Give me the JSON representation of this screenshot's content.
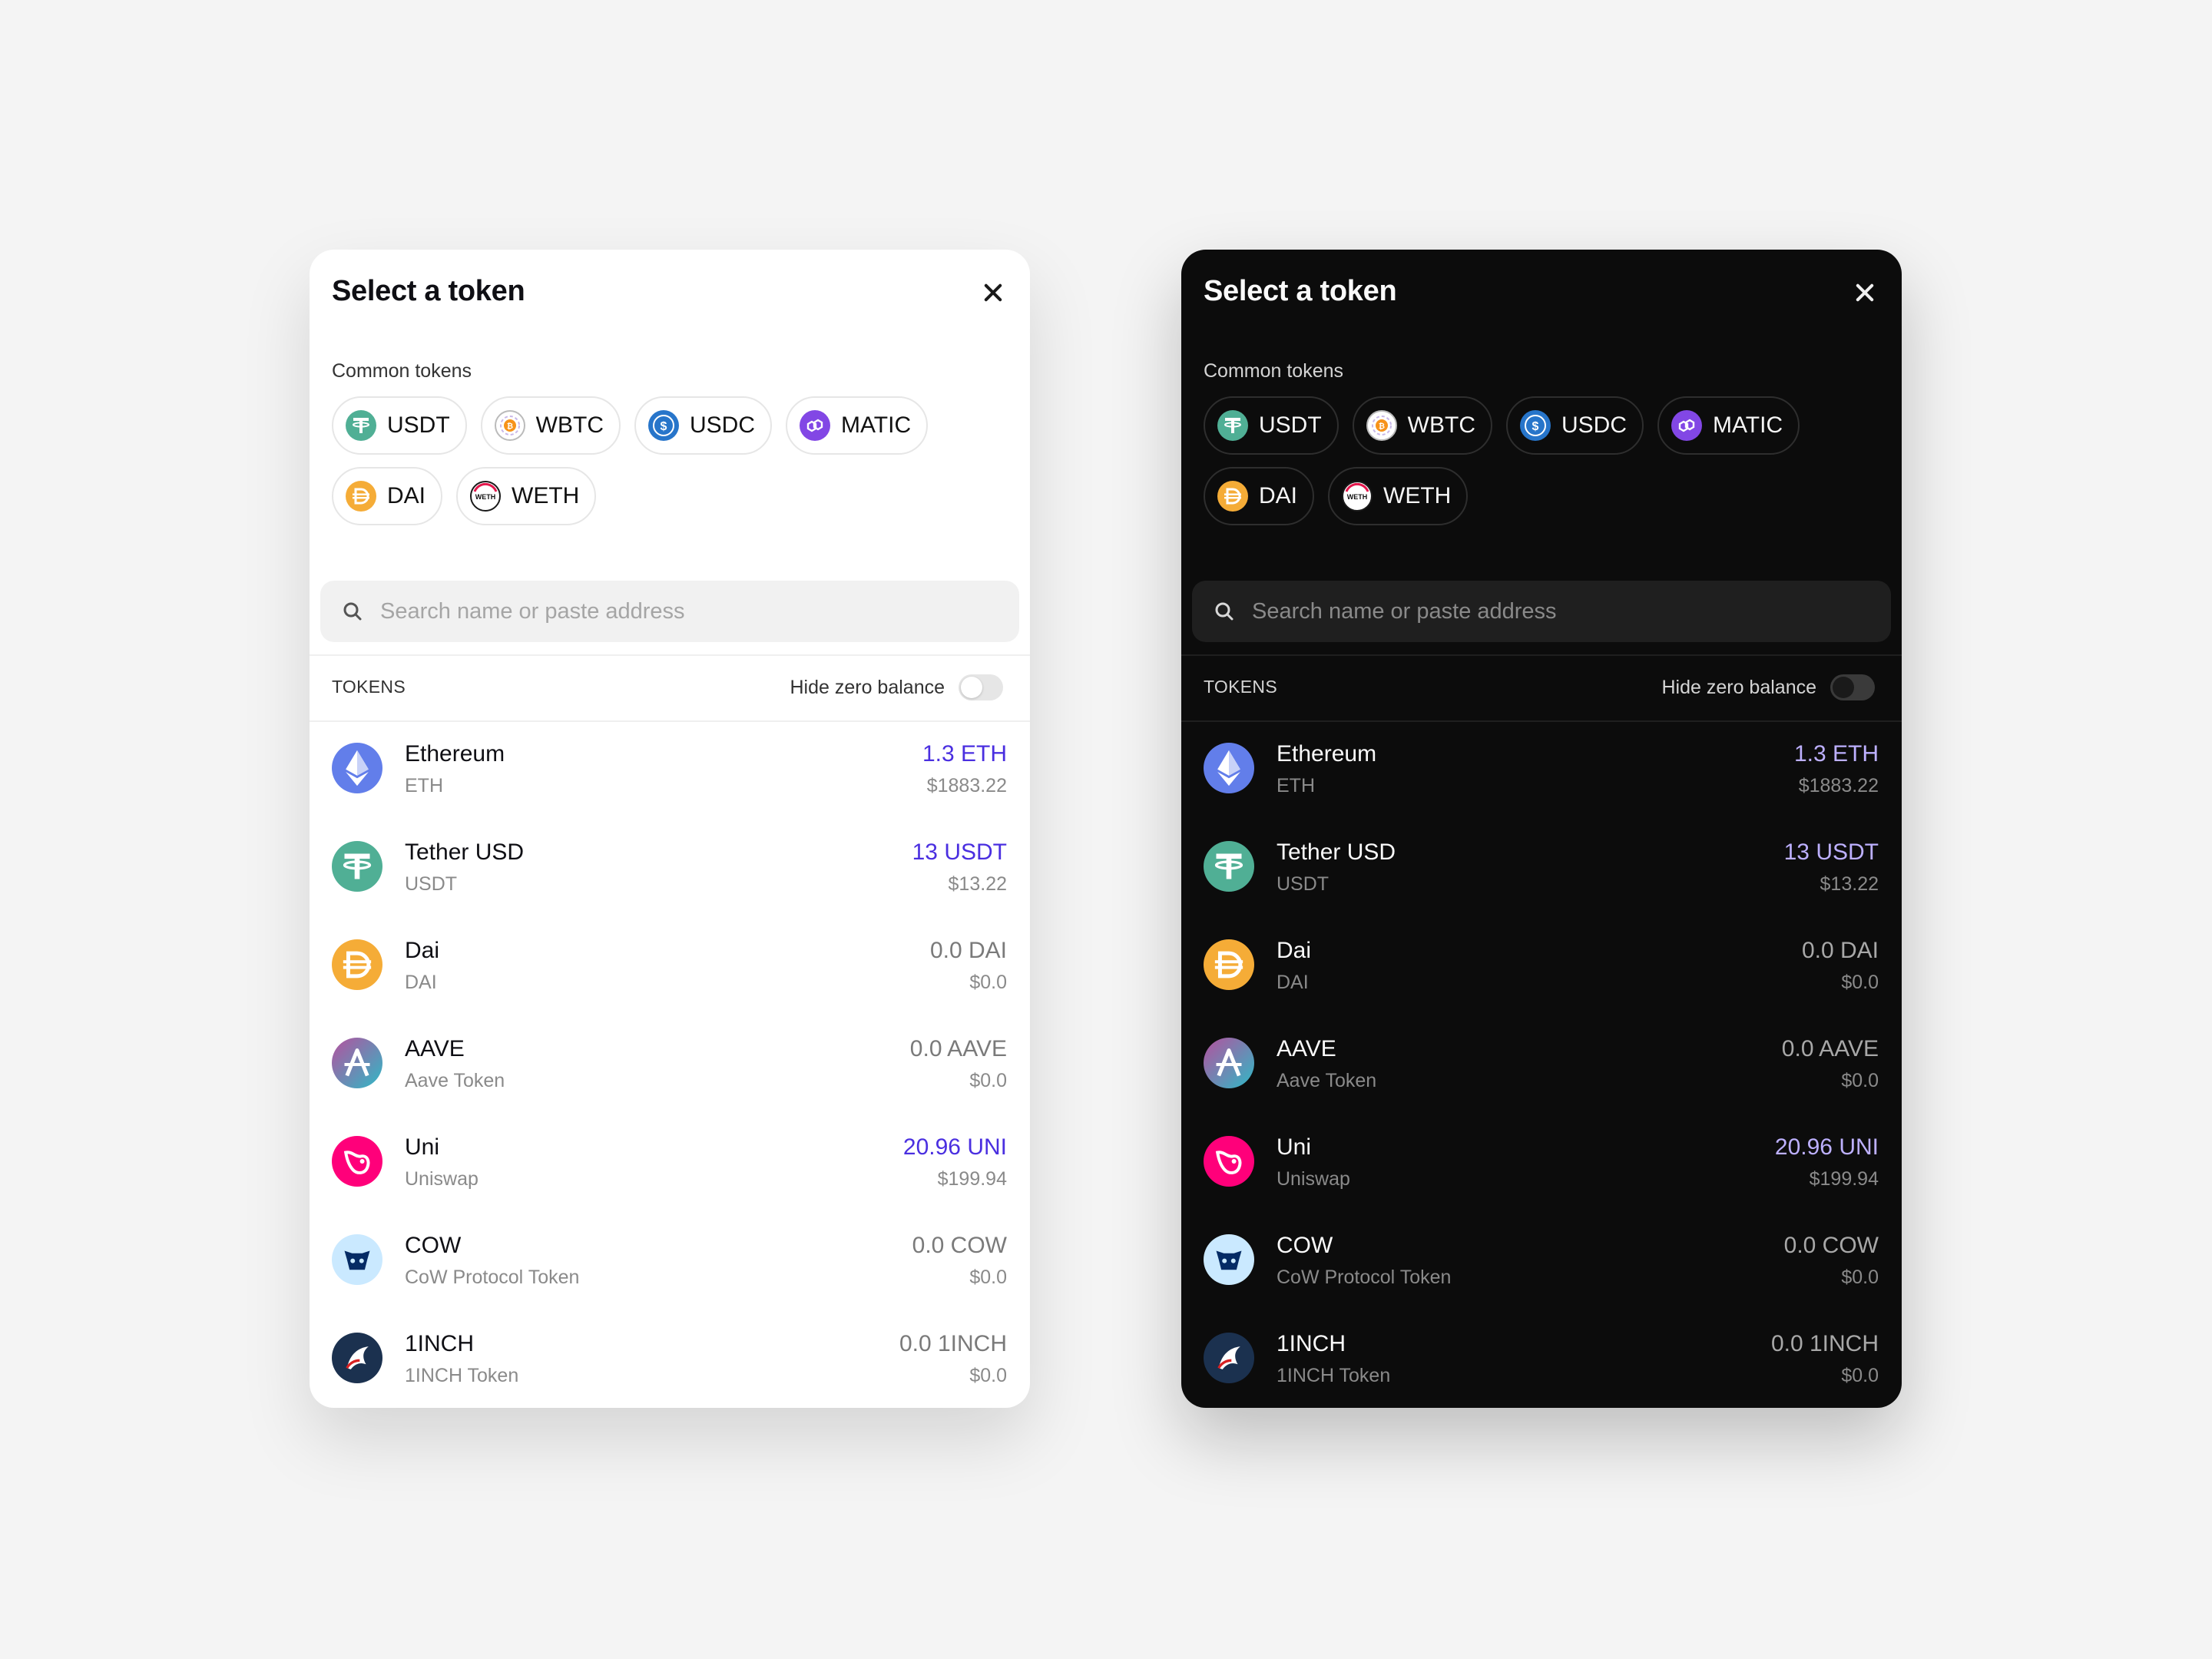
{
  "modal": {
    "title": "Select a token",
    "common_tokens_label": "Common tokens",
    "search_placeholder": "Search name or paste address",
    "tokens_header": "TOKENS",
    "hide_zero_label": "Hide zero balance",
    "hide_zero_enabled": false
  },
  "colors": {
    "light_bg": "#ffffff",
    "dark_bg": "#0c0c0c",
    "positive_amount_light": "#4a2fe0",
    "positive_amount_dark": "#bdb0ff"
  },
  "common_tokens": [
    {
      "symbol": "USDT",
      "icon": "tether-icon"
    },
    {
      "symbol": "WBTC",
      "icon": "wbtc-icon"
    },
    {
      "symbol": "USDC",
      "icon": "usdc-icon"
    },
    {
      "symbol": "MATIC",
      "icon": "matic-icon"
    },
    {
      "symbol": "DAI",
      "icon": "dai-icon"
    },
    {
      "symbol": "WETH",
      "icon": "weth-icon"
    }
  ],
  "tokens": [
    {
      "name": "Ethereum",
      "symbol": "ETH",
      "amount": "1.3 ETH",
      "usd": "$1883.22",
      "icon": "ethereum-icon",
      "positive": true
    },
    {
      "name": "Tether USD",
      "symbol": "USDT",
      "amount": "13 USDT",
      "usd": "$13.22",
      "icon": "tether-icon",
      "positive": true
    },
    {
      "name": "Dai",
      "symbol": "DAI",
      "amount": "0.0 DAI",
      "usd": "$0.0",
      "icon": "dai-icon",
      "positive": false
    },
    {
      "name": "AAVE",
      "symbol": "Aave Token",
      "amount": "0.0 AAVE",
      "usd": "$0.0",
      "icon": "aave-icon",
      "positive": false
    },
    {
      "name": "Uni",
      "symbol": "Uniswap",
      "amount": "20.96 UNI",
      "usd": "$199.94",
      "icon": "uniswap-icon",
      "positive": true
    },
    {
      "name": "COW",
      "symbol": "CoW Protocol Token",
      "amount": "0.0 COW",
      "usd": "$0.0",
      "icon": "cow-icon",
      "positive": false
    },
    {
      "name": "1INCH",
      "symbol": "1INCH Token",
      "amount": "0.0 1INCH",
      "usd": "$0.0",
      "icon": "1inch-icon",
      "positive": false
    }
  ]
}
